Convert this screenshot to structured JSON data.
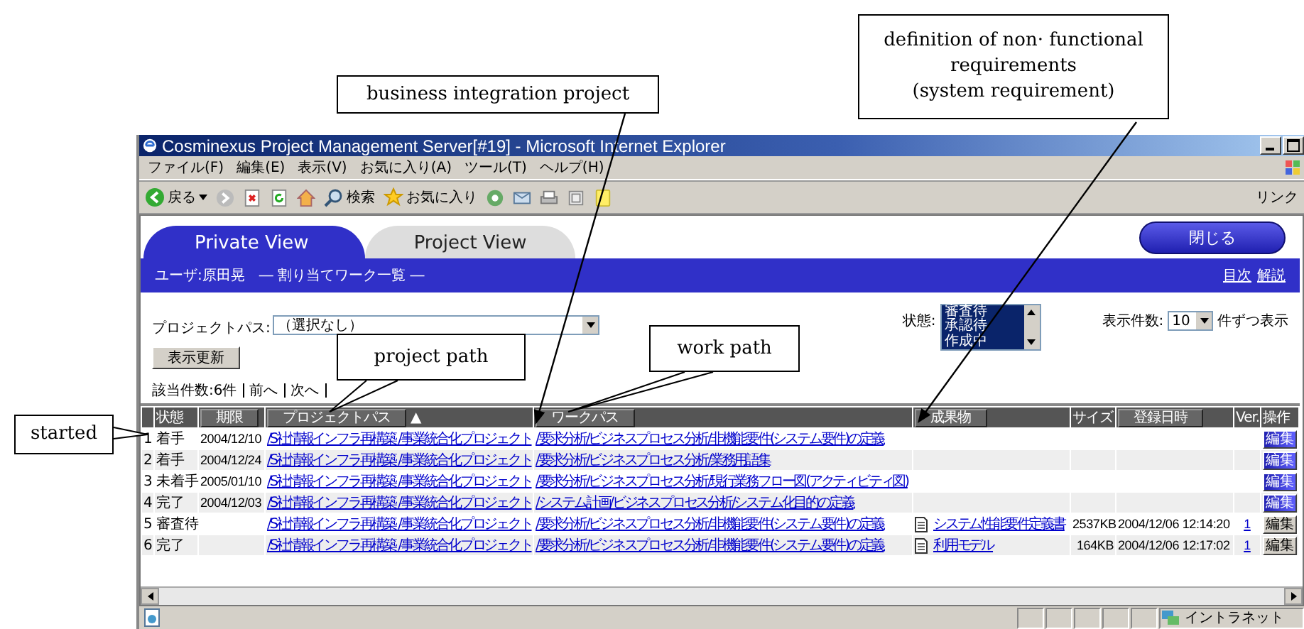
{
  "callouts": [
    {
      "text": "business integration project",
      "kind": "arrow"
    },
    {
      "text": "definition of non· functional\nrequirements\n(system requirement)",
      "kind": "arrow"
    },
    {
      "text": "project path",
      "kind": "tail"
    },
    {
      "text": "work path",
      "kind": "tail"
    },
    {
      "text": "started",
      "kind": "tail"
    }
  ],
  "window": {
    "title": "Cosminexus Project Management Server[#19] - Microsoft Internet Explorer"
  },
  "menu": [
    "ファイル(F)",
    "編集(E)",
    "表示(V)",
    "お気に入り(A)",
    "ツール(T)",
    "ヘルプ(H)"
  ],
  "toolbar": {
    "back": "戻る",
    "search": "検索",
    "favorites": "お気に入り",
    "links": "リンク"
  },
  "tabs": [
    {
      "label": "Private View",
      "selected": true
    },
    {
      "label": "Project View",
      "selected": false
    }
  ],
  "close_button": "閉じる",
  "header_bar": {
    "user": "ユーザ:原田晃　― 割り当てワーク一覧 ―",
    "links": [
      "目次",
      "解説"
    ]
  },
  "filters": {
    "project_label": "プロジェクトパス:",
    "project_value": "（選択なし）",
    "state_label": "状態:",
    "states": [
      {
        "label": "審査待",
        "selected": true
      },
      {
        "label": "承認待",
        "selected": true
      },
      {
        "label": "作成中",
        "selected": true
      }
    ],
    "count_label": "表示件数:",
    "count_value": "10",
    "count_suffix": "件ずつ表示",
    "update_button": "表示更新"
  },
  "result": {
    "count": "該当件数:6件",
    "links": [
      "前へ",
      "次へ"
    ]
  },
  "table": {
    "columns": [
      {
        "kind": "plain"
      },
      {
        "label": "状態",
        "kind": "plain"
      },
      {
        "label": "期限",
        "kind": "button"
      },
      {
        "label": "プロジェクトパス",
        "kind": "button",
        "sort": "▲"
      },
      {
        "label": "ワークパス",
        "kind": "button"
      },
      {
        "label": "成果物",
        "kind": "button"
      },
      {
        "label": "サイズ",
        "kind": "plain"
      },
      {
        "label": "登録日時",
        "kind": "button"
      },
      {
        "label": "Ver.",
        "kind": "plain"
      },
      {
        "label": "操作",
        "kind": "plain"
      }
    ],
    "rows": [
      {
        "no": "1",
        "status": "着手",
        "due": "2004/12/10",
        "project": "/S社情報インフラ再構築 /事業統合化プロジェクト",
        "work": "/要求分析/ビジネスプロセス分析/非機能要件(システム要件)の定義",
        "edit": {
          "label": "編集",
          "kind": "active"
        }
      },
      {
        "no": "2",
        "status": "着手",
        "due": "2004/12/24",
        "project": "/S社情報インフラ再構築 /事業統合化プロジェクト",
        "work": "/要求分析/ビジネスプロセス分析/業務用語集",
        "edit": {
          "label": "編集",
          "kind": "active"
        }
      },
      {
        "no": "3",
        "status": "未着手",
        "due": "2005/01/10",
        "project": "/S社情報インフラ再構築 /事業統合化プロジェクト",
        "work": "/要求分析/ビジネスプロセス分析/現行業務フロー図(アクティビティ図)",
        "edit": {
          "label": "編集",
          "kind": "active"
        }
      },
      {
        "no": "4",
        "status": "完了",
        "due": "2004/12/03",
        "project": "/S社情報インフラ再構築 /事業統合化プロジェクト",
        "work": "/システム計画/ビジネスプロセス分析/システム化目的の定義",
        "edit": {
          "label": "編集",
          "kind": "active"
        }
      },
      {
        "no": "5",
        "status": "審査待",
        "project": "/S社情報インフラ再構築 /事業統合化プロジェクト",
        "work": "/要求分析/ビジネスプロセス分析/非機能要件(システム要件)の定義",
        "deliverable": "システム性能要件定義書",
        "size": "2537KB",
        "registered": "2004/12/06 12:14:20",
        "ver": "1",
        "edit": {
          "label": "編集",
          "kind": "plain"
        }
      },
      {
        "no": "6",
        "status": "完了",
        "project": "/S社情報インフラ再構築 /事業統合化プロジェクト",
        "work": "/要求分析/ビジネスプロセス分析/非機能要件(システム要件)の定義",
        "deliverable": "利用モデル",
        "size": "164KB",
        "registered": "2004/12/06 12:17:02",
        "ver": "1",
        "edit": {
          "label": "編集",
          "kind": "plain"
        }
      }
    ]
  },
  "status_bar": {
    "zone": "イントラネット"
  }
}
